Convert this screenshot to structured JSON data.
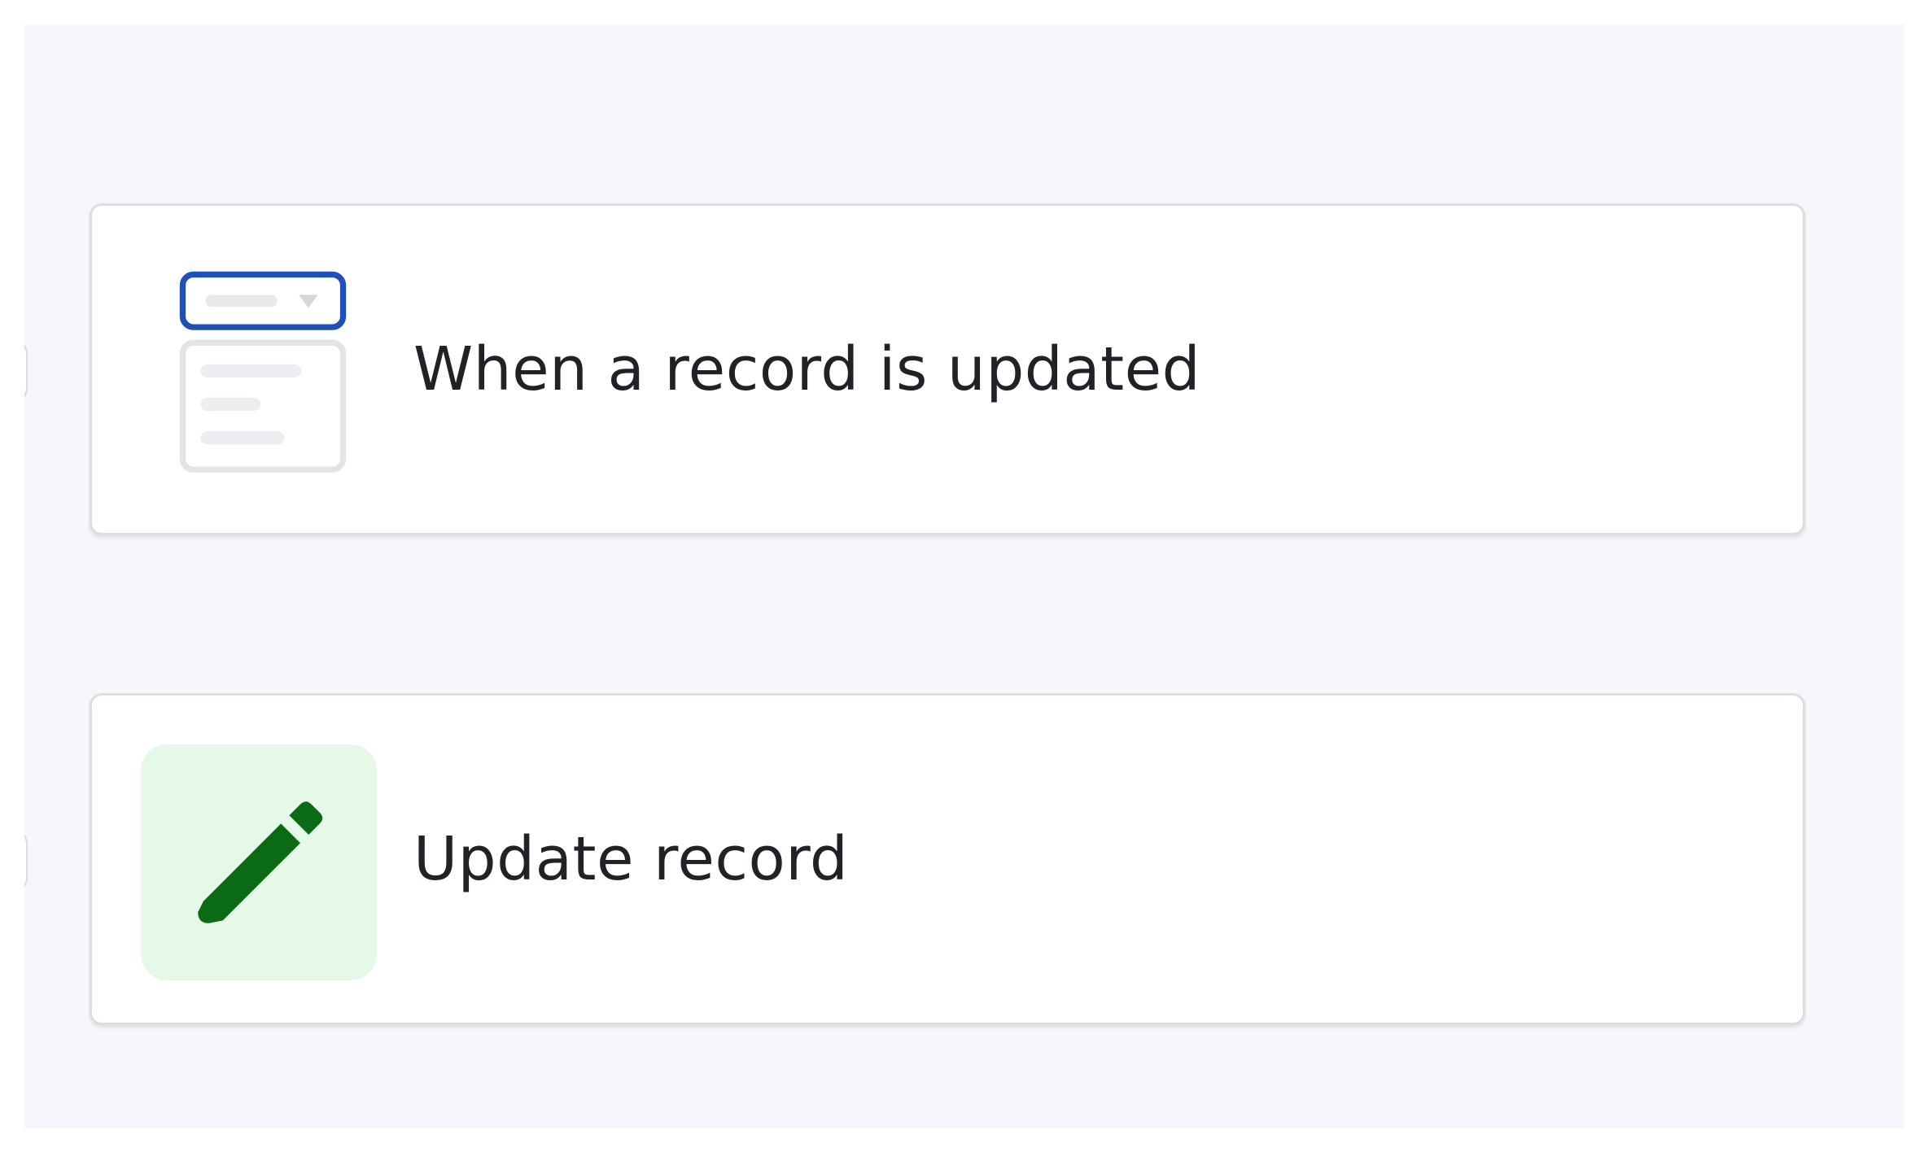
{
  "workflow": {
    "steps": [
      {
        "type": "trigger",
        "label": "When a record is updated",
        "icon": "form-dropdown-icon",
        "icon_accent": "#1f4fb8"
      },
      {
        "type": "action",
        "label": "Update record",
        "icon": "pencil-icon",
        "icon_color": "#0b6b14",
        "tile_color": "#e6f9e8"
      }
    ]
  },
  "colors": {
    "canvas_background": "#f6f7fa",
    "card_background": "#ffffff",
    "card_border": "#dcdde1",
    "text": "#1f2328"
  }
}
